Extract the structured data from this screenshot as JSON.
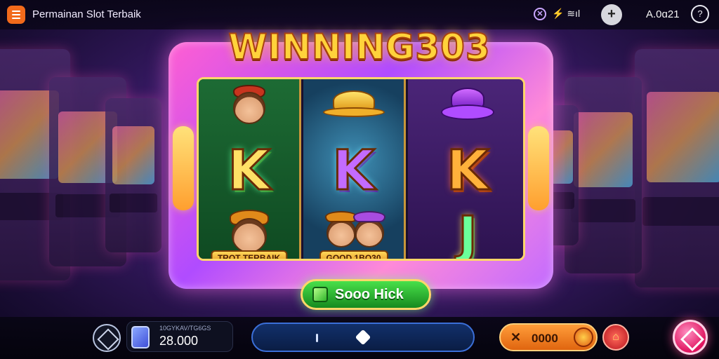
{
  "header": {
    "title": "Permainan Slot Terbaik",
    "signal": "⚡ ≋ıl",
    "account": "A.0ɑ21",
    "help": "?"
  },
  "logo": "WINNING303",
  "reels": [
    {
      "symbols": [
        "face-red-hat",
        "K",
        "face-gold-hat"
      ],
      "banner": "TROT TERBAIK"
    },
    {
      "symbols": [
        "gold-hat",
        "K",
        "two-faces"
      ],
      "banner": "GOOD 1BO30"
    },
    {
      "symbols": [
        "purple-hat",
        "K",
        "J"
      ],
      "banner": ""
    }
  ],
  "spin_button": {
    "label": "Sooo Hick"
  },
  "bottom": {
    "balance_label": "10GYKAV/TG6GS",
    "balance_value": "28.000",
    "bet_value": "0000",
    "bet_icon": "✕",
    "auto_icon": "⌂",
    "slider_level": 0.5
  },
  "colors": {
    "accent": "#f26a1b",
    "frame": "#b04cff",
    "spin": "#2fb52a",
    "main_action": "#e0145e"
  }
}
